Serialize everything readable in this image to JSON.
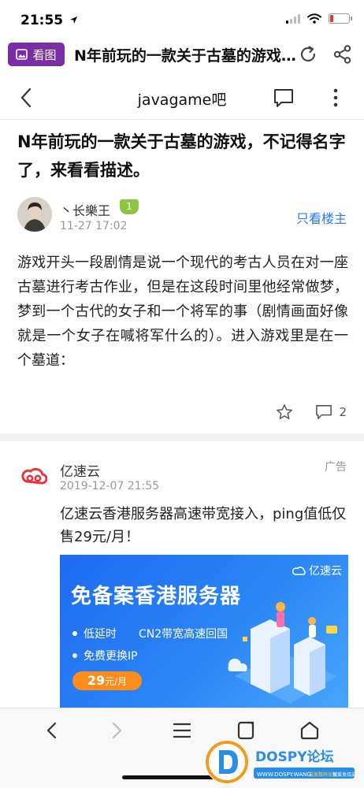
{
  "status_bar": {
    "time": "21:55"
  },
  "browser_bar": {
    "view_image_label": "看图",
    "page_title": "N年前玩的一款关于古墓的游戏，不记得名字了，来看看描述。"
  },
  "nav": {
    "forum_name": "javagame吧"
  },
  "post": {
    "title": "N年前玩的一款关于古墓的游戏，不记得名字了，来看看描述。",
    "author": "丶长樂王",
    "level": "1",
    "date": "11-27 17:02",
    "only_op_label": "只看楼主",
    "body": "游戏开头一段剧情是说一个现代的考古人员在对一座古墓进行考古作业，但是在这段时间里他经常做梦，梦到一个古代的女子和一个将军的事（剧情画面好像就是一个女子在喊将军什么的）。进入游戏里是在一个墓道：",
    "reply_count": "2"
  },
  "ad": {
    "advertiser": "亿速云",
    "tag": "广告",
    "date": "2019-12-07 21:55",
    "text": "亿速云香港服务器高速带宽接入，ping值低仅售29元/月！",
    "banner": {
      "brand": "亿速云",
      "headline": "免备案香港服务器",
      "feature_1a": "低延时",
      "feature_1b": "CN2带宽高速回国",
      "feature_2": "免费更换IP",
      "price_num": "29",
      "price_unit": "元/月"
    }
  },
  "watermark": {
    "brand": "DOSPY论坛",
    "url": "WWW.DOSPY.WANG",
    "tag1": "最爱数码论坛",
    "tag2": "就爱发烧友"
  },
  "colors": {
    "accent_blue": "#2d7bef",
    "view_image_purple": "#7a2ea4",
    "level_green": "#8cc63f",
    "ad_red": "#e8343b",
    "price_orange": "#ff8c1a"
  }
}
